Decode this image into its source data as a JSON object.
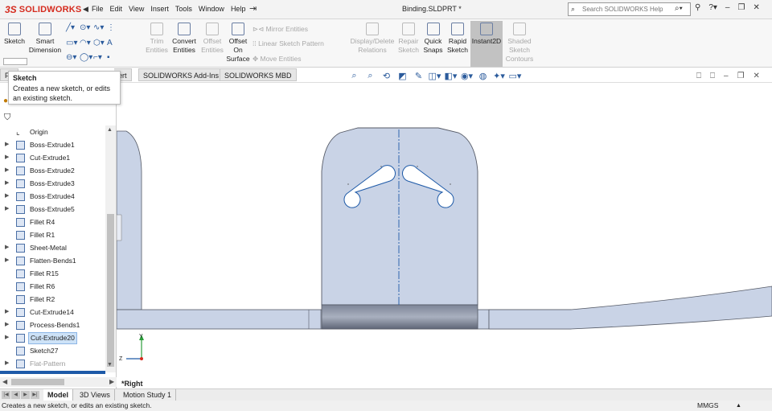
{
  "app": {
    "logo_mark": "3S",
    "logo_text": "SOLIDWORKS",
    "doc_title": "Binding.SLDPRT *"
  },
  "menu": [
    "File",
    "Edit",
    "View",
    "Insert",
    "Tools",
    "Window",
    "Help"
  ],
  "search": {
    "placeholder": "Search SOLIDWORKS Help"
  },
  "commands": {
    "sketch": "Sketch",
    "smart_dim_1": "Smart",
    "smart_dim_2": "Dimension",
    "trim_1": "Trim",
    "trim_2": "Entities",
    "convert_1": "Convert",
    "convert_2": "Entities",
    "offset_1": "Offset",
    "offset_2": "Entities",
    "offset_surf_1": "Offset",
    "offset_surf_2": "On",
    "offset_surf_3": "Surface",
    "mirror": "Mirror Entities",
    "linear_pattern": "Linear Sketch Pattern",
    "move": "Move Entities",
    "display_delete_1": "Display/Delete",
    "display_delete_2": "Relations",
    "repair_1": "Repair",
    "repair_2": "Sketch",
    "quick_snaps_1": "Quick",
    "quick_snaps_2": "Snaps",
    "rapid_1": "Rapid",
    "rapid_2": "Sketch",
    "instant2d": "Instant2D",
    "shaded_1": "Shaded",
    "shaded_2": "Sketch",
    "shaded_3": "Contours"
  },
  "tabs": {
    "t0": "Fe",
    "t1": "ert",
    "t2": "SOLIDWORKS Add-Ins",
    "t3": "SOLIDWORKS MBD"
  },
  "tooltip": {
    "title": "Sketch",
    "body": "Creates a new sketch, or edits an existing sketch."
  },
  "tree": {
    "origin": "Origin",
    "items": [
      "Boss-Extrude1",
      "Cut-Extrude1",
      "Boss-Extrude2",
      "Boss-Extrude3",
      "Boss-Extrude4",
      "Boss-Extrude5",
      "Fillet R4",
      "Fillet R1",
      "Sheet-Metal",
      "Flatten-Bends1",
      "Fillet R15",
      "Fillet R6",
      "Fillet R2",
      "Cut-Extrude14",
      "Process-Bends1",
      "Cut-Extrude20",
      "Sketch27",
      "Flat-Pattern"
    ]
  },
  "viewport": {
    "view_name": "*Right",
    "axis_y": "Y",
    "axis_z": "Z"
  },
  "bottom_tabs": [
    "Model",
    "3D Views",
    "Motion Study 1"
  ],
  "status": {
    "text": "Creates a new sketch, or edits an existing sketch.",
    "units": "MMGS"
  },
  "colors": {
    "brand": "#d52b1e",
    "part_face": "#c9d3e6",
    "part_dark": "#9aa4b8",
    "sketch_line": "#1e5aa8"
  }
}
